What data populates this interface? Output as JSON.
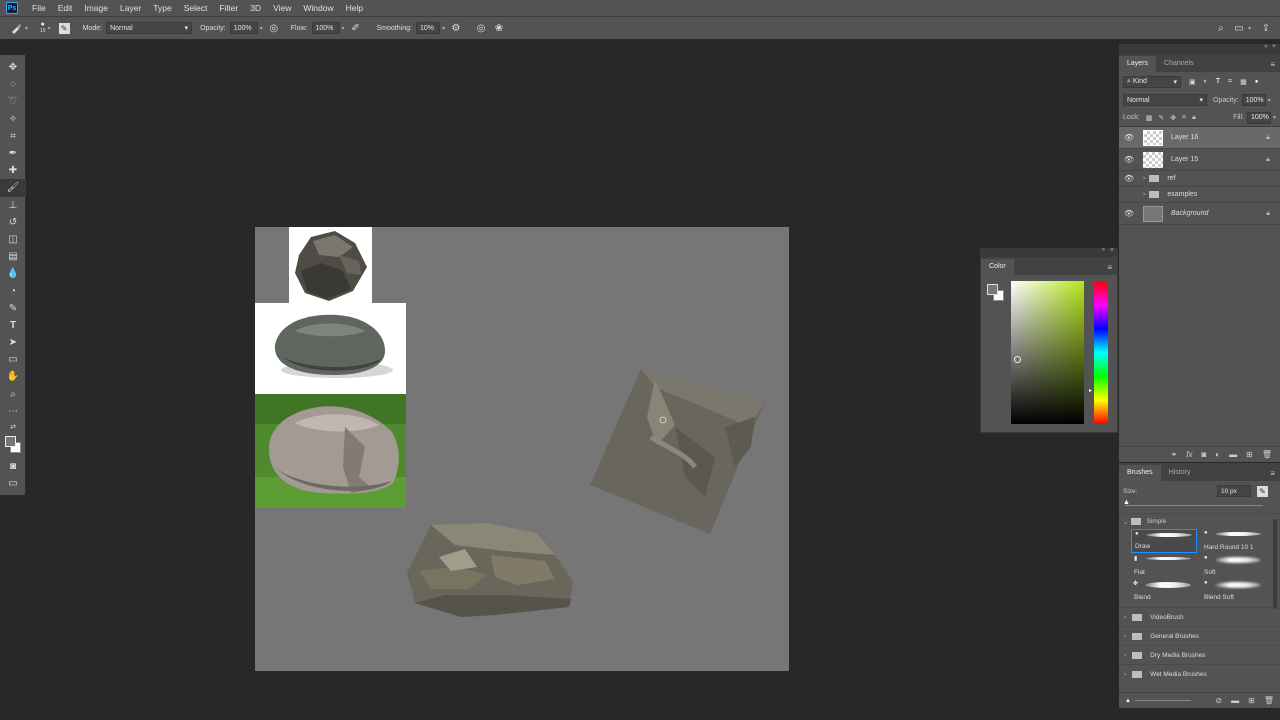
{
  "menubar": {
    "logo": "Ps",
    "items": [
      "File",
      "Edit",
      "Image",
      "Layer",
      "Type",
      "Select",
      "Filter",
      "3D",
      "View",
      "Window",
      "Help"
    ]
  },
  "options": {
    "brush_size": "10",
    "mode_label": "Mode:",
    "mode_value": "Normal",
    "opacity_label": "Opacity:",
    "opacity_value": "100%",
    "flow_label": "Flow:",
    "flow_value": "100%",
    "smoothing_label": "Smoothing:",
    "smoothing_value": "10%"
  },
  "layers_panel": {
    "tabs": [
      "Layers",
      "Channels"
    ],
    "filter_kind": "Kind",
    "blend_mode": "Normal",
    "opacity_label": "Opacity:",
    "opacity_value": "100%",
    "lock_label": "Lock:",
    "fill_label": "Fill:",
    "fill_value": "100%",
    "layers": [
      {
        "name": "Layer 16"
      },
      {
        "name": "Layer 15"
      },
      {
        "name": "ref"
      },
      {
        "name": "examples"
      },
      {
        "name": "Background"
      }
    ]
  },
  "color_panel": {
    "title": "Color"
  },
  "brushes_panel": {
    "tabs": [
      "Brushes",
      "History"
    ],
    "size_label": "Size:",
    "size_value": "10 px",
    "group_open": "Simple",
    "brushes": [
      "Draw",
      "Hard Round 10 1",
      "Flat",
      "Soft",
      "Blend",
      "Blend Soft"
    ],
    "groups": [
      "VideoBrush",
      "General Brushes",
      "Dry Media Brushes",
      "Wet Media Brushes"
    ]
  },
  "colors": {
    "ui_bg": "#535353",
    "workspace": "#282828",
    "canvas": "#767676",
    "accent_blue": "#31a8ff"
  }
}
